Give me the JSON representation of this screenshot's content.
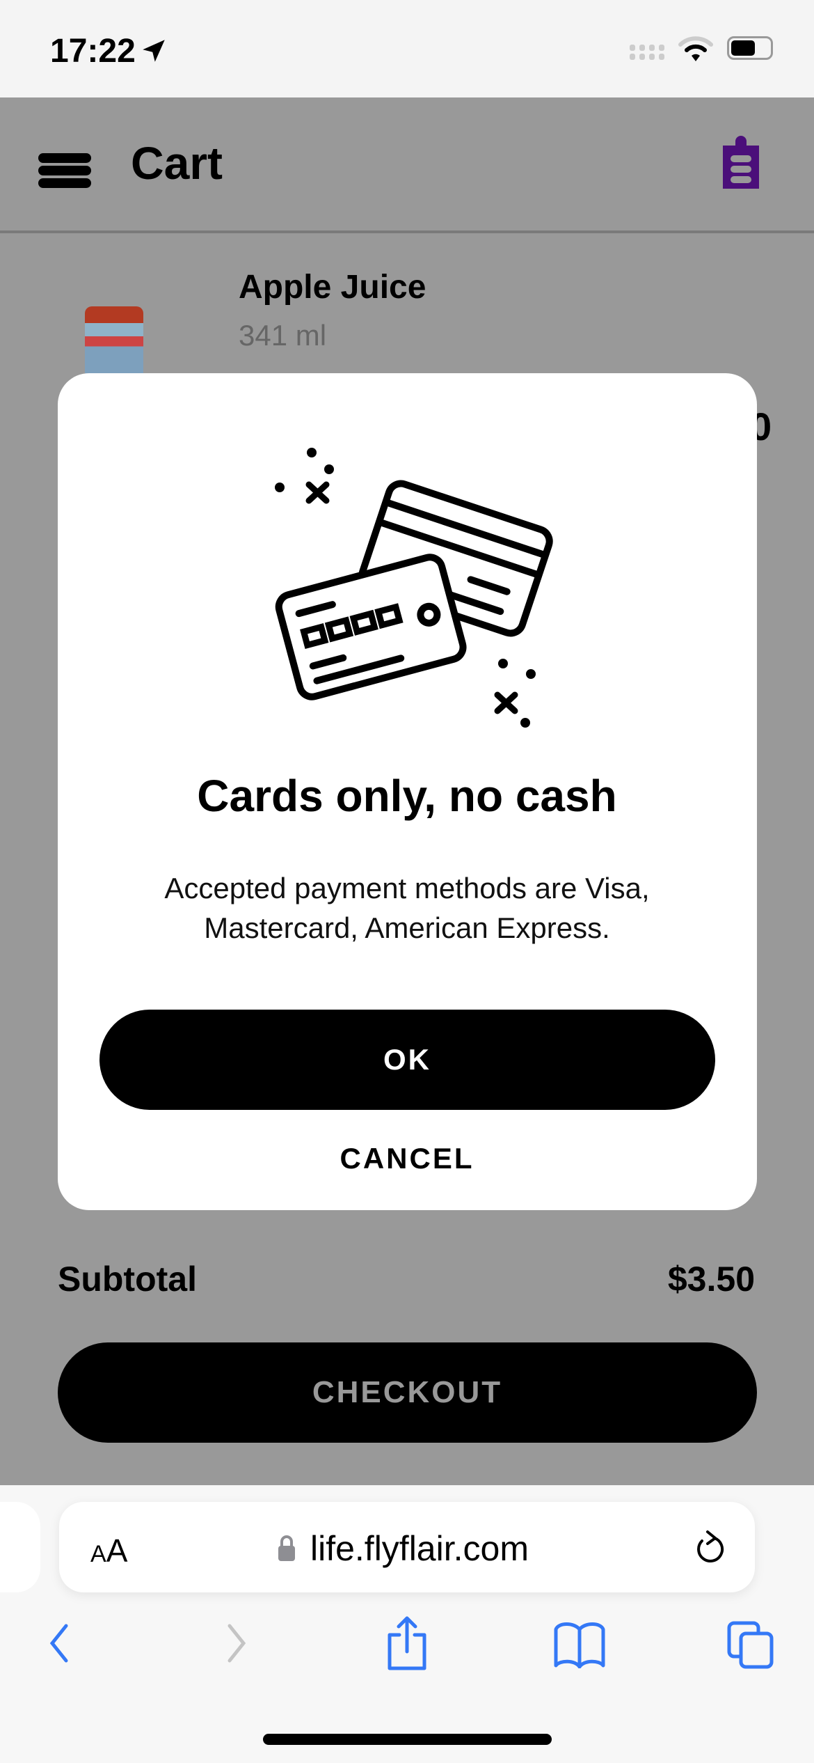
{
  "status_bar": {
    "time": "17:22",
    "icons": [
      "location-arrow-icon",
      "cellular-signal-icon",
      "wifi-icon",
      "battery-icon"
    ]
  },
  "header": {
    "title": "Cart",
    "menu_icon": "hamburger-menu-icon",
    "action_icon": "clipboard-list-icon",
    "action_color": "#4b0f7a"
  },
  "cart_item": {
    "name": "Apple Juice",
    "size": "341 ml",
    "price_fragment": "0"
  },
  "modal": {
    "illustration": "credit-cards-icon",
    "title": "Cards only, no cash",
    "body_line1": "Accepted payment methods are Visa,",
    "body_line2": "Mastercard, American Express.",
    "ok_label": "OK",
    "cancel_label": "CANCEL"
  },
  "summary": {
    "subtotal_label": "Subtotal",
    "subtotal_value": "$3.50",
    "checkout_label": "CHECKOUT"
  },
  "browser": {
    "text_size_label_small": "A",
    "text_size_label_large": "A",
    "url": "life.flyflair.com",
    "accent": "#3478f6"
  }
}
